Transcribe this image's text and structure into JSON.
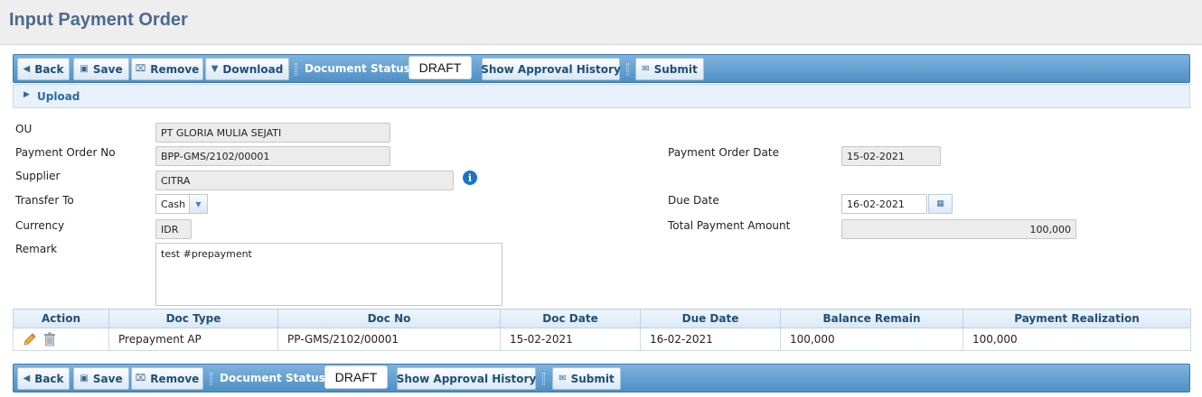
{
  "page": {
    "title": "Input Payment Order"
  },
  "toolbar_top": {
    "back": "Back",
    "save": "Save",
    "remove": "Remove",
    "download": "Download",
    "status_label": "Document Status:",
    "status_value": "DRAFT",
    "approval_history": "Show Approval History",
    "submit": "Submit"
  },
  "upload": {
    "label": "Upload"
  },
  "form": {
    "ou": {
      "label": "OU",
      "value": "PT GLORIA MULIA SEJATI"
    },
    "payment_order_no": {
      "label": "Payment Order No",
      "value": "BPP-GMS/2102/00001"
    },
    "supplier": {
      "label": "Supplier",
      "value": "CITRA"
    },
    "transfer_to": {
      "label": "Transfer To",
      "value": "Cash"
    },
    "currency": {
      "label": "Currency",
      "value": "IDR"
    },
    "remark": {
      "label": "Remark",
      "value": "test #prepayment"
    },
    "payment_order_date": {
      "label": "Payment Order Date",
      "value": "15-02-2021"
    },
    "due_date": {
      "label": "Due Date",
      "value": "16-02-2021"
    },
    "total_payment_amount": {
      "label": "Total Payment Amount",
      "value": "100,000"
    }
  },
  "table": {
    "headers": [
      "Action",
      "Doc Type",
      "Doc No",
      "Doc Date",
      "Due Date",
      "Balance Remain",
      "Payment Realization"
    ],
    "rows": [
      {
        "doc_type": "Prepayment AP",
        "doc_no": "PP-GMS/2102/00001",
        "doc_date": "15-02-2021",
        "due_date": "16-02-2021",
        "balance_remain": "100,000",
        "payment_realization": "100,000"
      }
    ]
  },
  "toolbar_bottom": {
    "back": "Back",
    "save": "Save",
    "remove": "Remove",
    "status_label": "Document Status:",
    "status_value": "DRAFT",
    "approval_history": "Show Approval History",
    "submit": "Submit"
  },
  "colors": {
    "toolbar": "#5b9bd0",
    "title": "#4d6a8c",
    "info_icon": "#1b74c5"
  },
  "icons": {
    "back": "triangle-left-icon",
    "save": "floppy-icon",
    "remove": "trash-icon",
    "download": "triangle-down-icon",
    "submit": "envelope-icon",
    "upload": "triangle-right-icon",
    "calendar": "calendar-icon",
    "info": "info-icon",
    "edit": "pencil-icon"
  }
}
